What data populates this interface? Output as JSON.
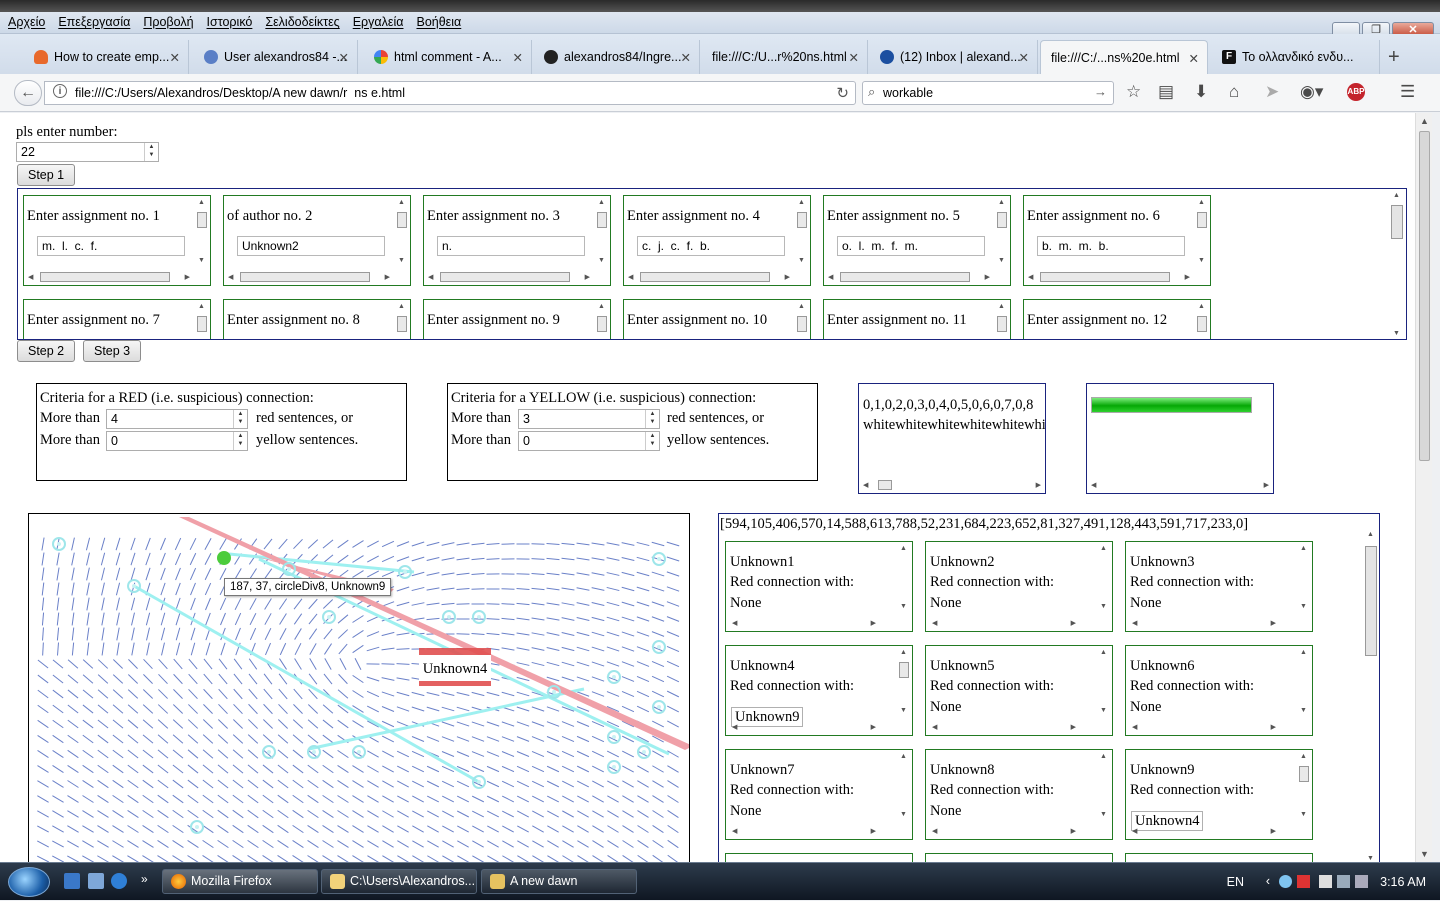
{
  "browser": {
    "menu": [
      "Αρχείο",
      "Επεξεργασία",
      "Προβολή",
      "Ιστορικό",
      "Σελιδοδείκτες",
      "Εργαλεία",
      "Βοήθεια"
    ],
    "tabs": [
      {
        "title": "How to create emp...",
        "icon": "fire-icon",
        "color": "#e8692b"
      },
      {
        "title": "User alexandros84 -...",
        "icon": "php-icon",
        "color": "#5a7fc6"
      },
      {
        "title": "html comment - A...",
        "icon": "google-icon",
        "color": "#4285f4"
      },
      {
        "title": "alexandros84/Ingre...",
        "icon": "github-icon",
        "color": "#222222"
      },
      {
        "title": "file:///C:/U...r%20ns.html",
        "icon": "",
        "color": ""
      },
      {
        "title": "(12) Inbox | alexand...",
        "icon": "mail-icon",
        "color": "#1b4fa0"
      },
      {
        "title": "file:///C:/...ns%20e.html",
        "icon": "",
        "color": ""
      },
      {
        "title": "Το ολλανδικό ενδυ...",
        "icon": "f-icon",
        "color": "#111111"
      }
    ],
    "new_tab": "+",
    "url": "file:///C:/Users/Alexandros/Desktop/A new dawn/r  ns e.html",
    "search_value": "workable"
  },
  "page": {
    "prompt": "pls enter number:",
    "number_value": "22",
    "step1": "Step 1",
    "step2": "Step 2",
    "step3": "Step 3",
    "assignments": [
      {
        "label": "Enter assignment no. 1",
        "value": "m.  l.  c.  f."
      },
      {
        "label": "of author no. 2",
        "value": "Unknown2"
      },
      {
        "label": "Enter assignment no. 3",
        "value": "n."
      },
      {
        "label": "Enter assignment no. 4",
        "value": "c.  j.  c.  f.  b."
      },
      {
        "label": "Enter assignment no. 5",
        "value": "o.  l.  m.  f.  m."
      },
      {
        "label": "Enter assignment no. 6",
        "value": "b.  m.  m.  b."
      },
      {
        "label": "Enter assignment no. 7",
        "value": ""
      },
      {
        "label": "Enter assignment no. 8",
        "value": ""
      },
      {
        "label": "Enter assignment no. 9",
        "value": ""
      },
      {
        "label": "Enter assignment no. 10",
        "value": ""
      },
      {
        "label": "Enter assignment no. 11",
        "value": ""
      },
      {
        "label": "Enter assignment no. 12",
        "value": ""
      }
    ],
    "red_criteria": {
      "title": "Criteria for a RED (i.e. suspicious) connection:",
      "more_than": "More than",
      "red_value": "4",
      "red_suffix": "red sentences, or",
      "yellow_value": "0",
      "yellow_suffix": "yellow sentences."
    },
    "yellow_criteria": {
      "title": "Criteria for a YELLOW (i.e. suspicious) connection:",
      "more_than": "More than",
      "red_value": "3",
      "red_suffix": "red sentences, or",
      "yellow_value": "0",
      "yellow_suffix": "yellow sentences."
    },
    "output_line1": "0,1,0,2,0,3,0,4,0,5,0,6,0,7,0,8",
    "output_line2": "whitewhitewhitewhitewhitewhitewhite",
    "progress_fraction": 1.0,
    "graph": {
      "tooltip": "187, 37, circleDiv8, Unknown9",
      "highlight_label": "Unknown4",
      "red_line_color": "#f0a0a8",
      "cyan_line_color": "#9ef0f0",
      "highlight_node_color": "#4ccc3c"
    },
    "results_array": "[594,105,406,570,14,588,613,788,52,231,684,223,652,81,327,491,128,443,591,717,233,0]",
    "results": [
      {
        "name": "Unknown1",
        "label": "Red connection with:",
        "value": "None",
        "boxed": false
      },
      {
        "name": "Unknown2",
        "label": "Red connection with:",
        "value": "None",
        "boxed": false
      },
      {
        "name": "Unknown3",
        "label": "Red connection with:",
        "value": "None",
        "boxed": false
      },
      {
        "name": "Unknown4",
        "label": "Red connection with:",
        "value": "Unknown9",
        "boxed": true
      },
      {
        "name": "Unknown5",
        "label": "Red connection with:",
        "value": "None",
        "boxed": false
      },
      {
        "name": "Unknown6",
        "label": "Red connection with:",
        "value": "None",
        "boxed": false
      },
      {
        "name": "Unknown7",
        "label": "Red connection with:",
        "value": "None",
        "boxed": false
      },
      {
        "name": "Unknown8",
        "label": "Red connection with:",
        "value": "None",
        "boxed": false
      },
      {
        "name": "Unknown9",
        "label": "Red connection with:",
        "value": "Unknown4",
        "boxed": true
      }
    ]
  },
  "taskbar": {
    "items": [
      {
        "label": "Mozilla Firefox",
        "icon": "firefox-icon",
        "color": "#e66000"
      },
      {
        "label": "C:\\Users\\Alexandros...",
        "icon": "notepad-icon",
        "color": "#f2d27a"
      },
      {
        "label": "A new dawn",
        "icon": "folder-icon",
        "color": "#e6c260"
      }
    ],
    "lang": "EN",
    "time": "3:16 AM"
  }
}
